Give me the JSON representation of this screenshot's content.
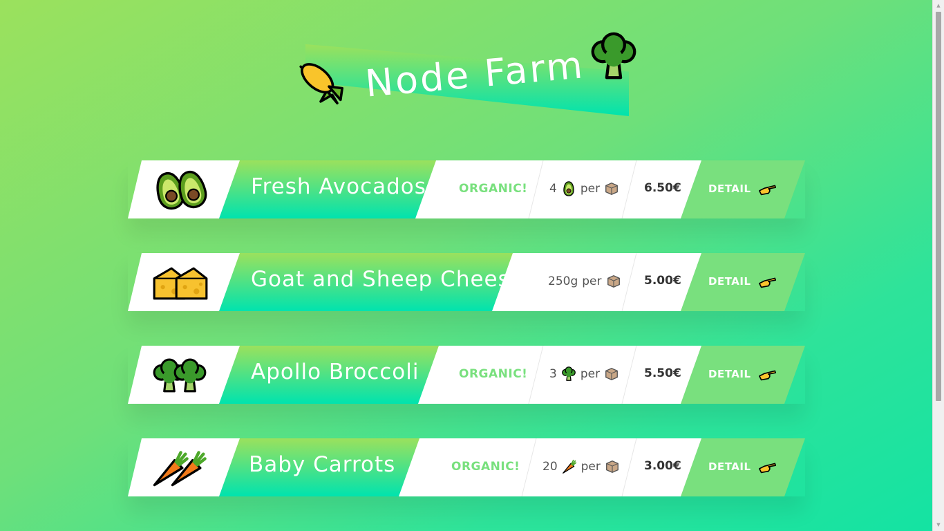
{
  "header": {
    "title": "Node Farm",
    "left_icon": "corn-icon",
    "right_icon": "broccoli-icon"
  },
  "products": [
    {
      "name": "Fresh Avocados",
      "icon": "avocado-icon",
      "organic_label": "ORGANIC!",
      "quantity": "4",
      "per": "per",
      "unit_icon": "box-icon",
      "price": "6.50€",
      "detail_label": "DETAIL"
    },
    {
      "name": "Goat and Sheep Cheese",
      "icon": "cheese-icon",
      "organic_label": "",
      "quantity": "250g",
      "per": "per",
      "unit_icon": "box-icon",
      "price": "5.00€",
      "detail_label": "DETAIL"
    },
    {
      "name": "Apollo Broccoli",
      "icon": "broccoli-icon",
      "organic_label": "ORGANIC!",
      "quantity": "3",
      "per": "per",
      "unit_icon": "box-icon",
      "price": "5.50€",
      "detail_label": "DETAIL"
    },
    {
      "name": "Baby Carrots",
      "icon": "carrot-icon",
      "organic_label": "ORGANIC!",
      "quantity": "20",
      "per": "per",
      "unit_icon": "box-icon",
      "price": "3.00€",
      "detail_label": "DETAIL"
    }
  ],
  "colors": {
    "accent": "#79e07e",
    "gradient_start": "#9be15d",
    "gradient_end": "#00e3ae"
  }
}
